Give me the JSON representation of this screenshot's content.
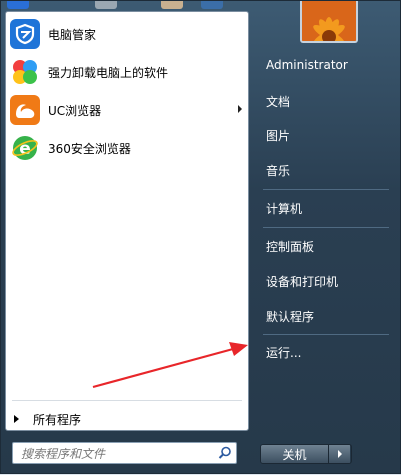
{
  "left_pane": {
    "programs": [
      {
        "label": "电脑管家",
        "icon": "tencent-pc-manager-icon"
      },
      {
        "label": "强力卸载电脑上的软件",
        "icon": "uninstall-icon"
      },
      {
        "label": "UC浏览器",
        "icon": "uc-browser-icon",
        "has_submenu": true
      },
      {
        "label": "360安全浏览器",
        "icon": "360-browser-icon"
      }
    ],
    "all_programs_label": "所有程序",
    "search_placeholder": "搜索程序和文件"
  },
  "right_pane": {
    "items": [
      {
        "label": "Administrator"
      },
      {
        "label": "文档"
      },
      {
        "label": "图片"
      },
      {
        "label": "音乐"
      },
      {
        "label": "计算机"
      },
      {
        "label": "控制面板"
      },
      {
        "label": "设备和打印机"
      },
      {
        "label": "默认程序"
      },
      {
        "label": "运行..."
      }
    ],
    "shutdown_label": "关机"
  },
  "colors": {
    "accent_red": "#e8262a",
    "menu_bg": "#2f4659"
  }
}
